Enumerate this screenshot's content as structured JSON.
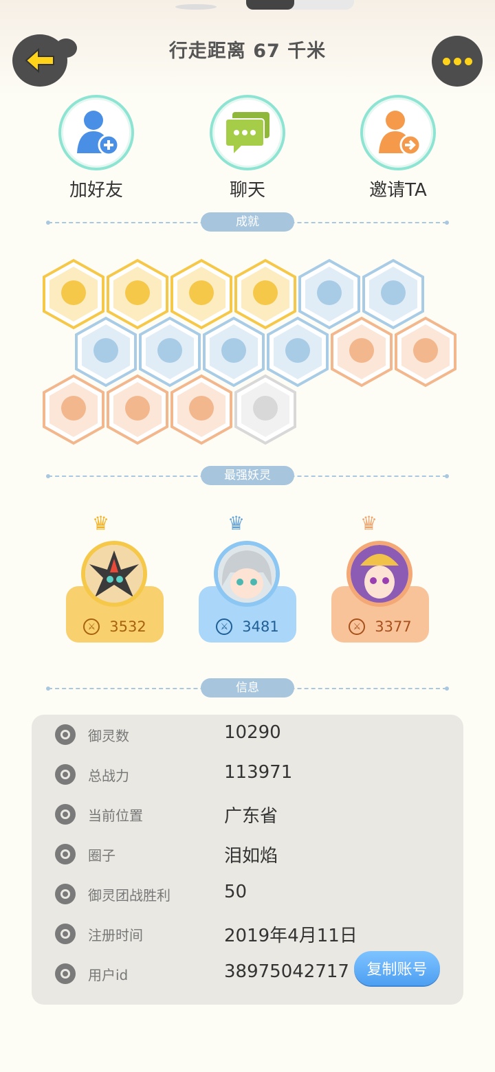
{
  "header": {
    "title": "行走距离 67 千米"
  },
  "actions": [
    {
      "label": "加好友"
    },
    {
      "label": "聊天"
    },
    {
      "label": "邀请TA"
    }
  ],
  "sections": {
    "achievements": "成就",
    "strongest": "最强妖灵",
    "info": "信息"
  },
  "achievements": {
    "colors": [
      "#f6c84a",
      "#f6c84a",
      "#f6c84a",
      "#f6c84a",
      "#a9cce6",
      "#a9cce6",
      "#a9cce6",
      "#a9cce6",
      "#a9cce6",
      "#a9cce6",
      "#f3b78d",
      "#f3b78d",
      "#f3b78d",
      "#f3b78d",
      "#f3b78d",
      "#d8d8d8"
    ]
  },
  "spirits": [
    {
      "power": "3532",
      "color": "#f8d06e",
      "ring": "#f6c84a",
      "text": "#a6620e"
    },
    {
      "power": "3481",
      "color": "#a9d6f9",
      "ring": "#8cc6f2",
      "text": "#1f5f95"
    },
    {
      "power": "3377",
      "color": "#f9c39a",
      "ring": "#f4a876",
      "text": "#a6501b"
    }
  ],
  "info": {
    "rows": [
      {
        "key": "御灵数",
        "value": "10290"
      },
      {
        "key": "总战力",
        "value": "113971"
      },
      {
        "key": "当前位置",
        "value": "广东省"
      },
      {
        "key": "圈子",
        "value": "泪如焰"
      },
      {
        "key": "御灵团战胜利",
        "value": "50"
      },
      {
        "key": "注册时间",
        "value": "2019年4月11日"
      },
      {
        "key": "用户id",
        "value": "38975042717"
      }
    ],
    "copy_label": "复制账号"
  }
}
